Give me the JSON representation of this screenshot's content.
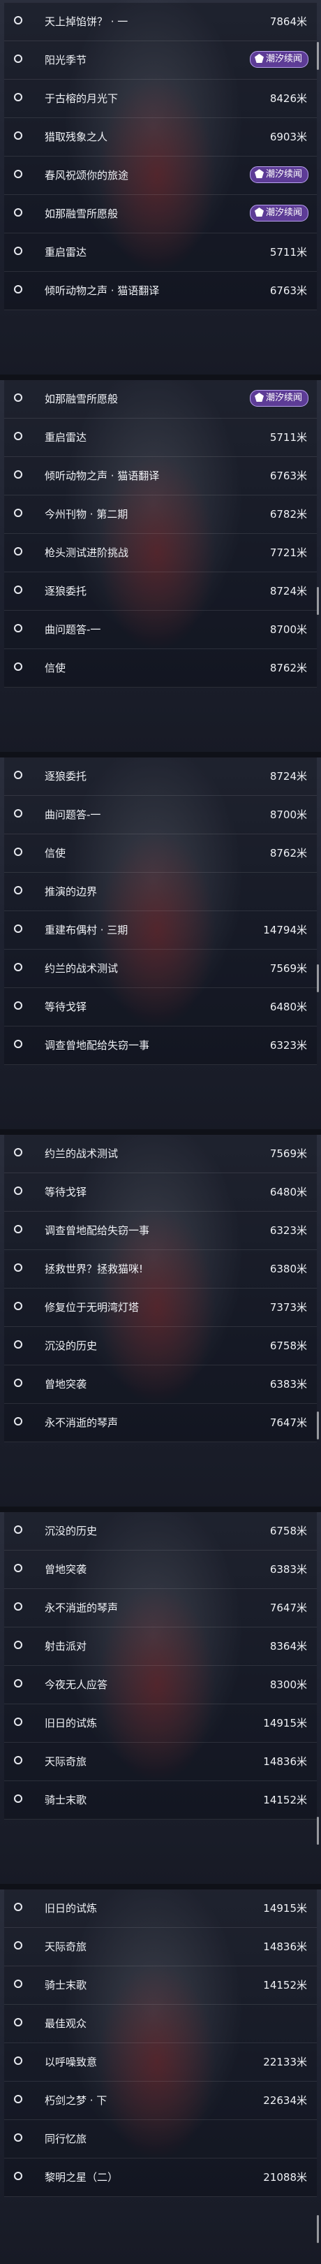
{
  "badge_label": "潮汐续闻",
  "screens": [
    {
      "rows": [
        {
          "name": "天上掉馅饼？ · 一",
          "distance": "7864米"
        },
        {
          "name": "阳光季节",
          "badge": true
        },
        {
          "name": "于古榕的月光下",
          "distance": "8426米"
        },
        {
          "name": "猎取残象之人",
          "distance": "6903米"
        },
        {
          "name": "春风祝颂你的旅途",
          "badge": true
        },
        {
          "name": "如那融雪所愿般",
          "badge": true
        },
        {
          "name": "重启雷达",
          "distance": "5711米"
        },
        {
          "name": "倾听动物之声 · 猫语翻译",
          "distance": "6763米"
        }
      ]
    },
    {
      "rows": [
        {
          "name": "如那融雪所愿般",
          "badge": true
        },
        {
          "name": "重启雷达",
          "distance": "5711米"
        },
        {
          "name": "倾听动物之声 · 猫语翻译",
          "distance": "6763米"
        },
        {
          "name": "今州刊物 · 第二期",
          "distance": "6782米"
        },
        {
          "name": "枪头测试进阶挑战",
          "distance": "7721米"
        },
        {
          "name": "逐狼委托",
          "distance": "8724米"
        },
        {
          "name": "曲问题答-一",
          "distance": "8700米"
        },
        {
          "name": "信使",
          "distance": "8762米"
        }
      ]
    },
    {
      "rows": [
        {
          "name": "逐狼委托",
          "distance": "8724米"
        },
        {
          "name": "曲问题答-一",
          "distance": "8700米"
        },
        {
          "name": "信使",
          "distance": "8762米"
        },
        {
          "name": "推演的边界",
          "distance": ""
        },
        {
          "name": "重建布偶村 · 三期",
          "distance": "14794米"
        },
        {
          "name": "约兰的战术测试",
          "distance": "7569米"
        },
        {
          "name": "等待戈铎",
          "distance": "6480米"
        },
        {
          "name": "调查曾地配给失窃一事",
          "distance": "6323米"
        }
      ]
    },
    {
      "rows": [
        {
          "name": "约兰的战术测试",
          "distance": "7569米"
        },
        {
          "name": "等待戈铎",
          "distance": "6480米"
        },
        {
          "name": "调查曾地配给失窃一事",
          "distance": "6323米"
        },
        {
          "name": "拯救世界？拯救猫咪!",
          "distance": "6380米"
        },
        {
          "name": "修复位于无明湾灯塔",
          "distance": "7373米"
        },
        {
          "name": "沉没的历史",
          "distance": "6758米"
        },
        {
          "name": "曾地突袭",
          "distance": "6383米"
        },
        {
          "name": "永不消逝的琴声",
          "distance": "7647米"
        }
      ]
    },
    {
      "rows": [
        {
          "name": "沉没的历史",
          "distance": "6758米"
        },
        {
          "name": "曾地突袭",
          "distance": "6383米"
        },
        {
          "name": "永不消逝的琴声",
          "distance": "7647米"
        },
        {
          "name": "射击派对",
          "distance": "8364米"
        },
        {
          "name": "今夜无人应答",
          "distance": "8300米"
        },
        {
          "name": "旧日的试炼",
          "distance": "14915米"
        },
        {
          "name": "天际奇旅",
          "distance": "14836米"
        },
        {
          "name": "骑士末歌",
          "distance": "14152米"
        }
      ]
    },
    {
      "rows": [
        {
          "name": "旧日的试炼",
          "distance": "14915米"
        },
        {
          "name": "天际奇旅",
          "distance": "14836米"
        },
        {
          "name": "骑士末歌",
          "distance": "14152米"
        },
        {
          "name": "最佳观众",
          "distance": ""
        },
        {
          "name": "以呼噪致意",
          "distance": "22133米"
        },
        {
          "name": "朽剑之梦 · 下",
          "distance": "22634米"
        },
        {
          "name": "同行忆旅",
          "distance": ""
        },
        {
          "name": "黎明之星（二）",
          "distance": "21088米"
        }
      ]
    }
  ]
}
